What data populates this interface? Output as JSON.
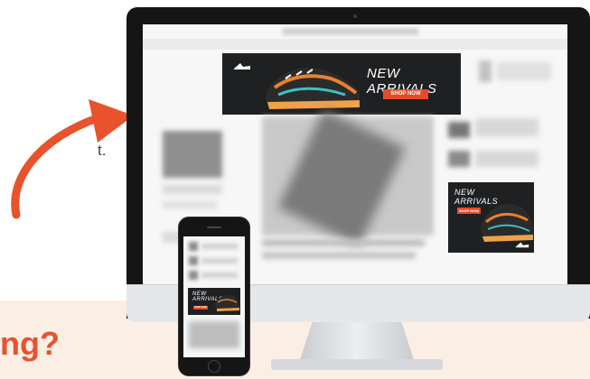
{
  "left_fragment": {
    "line1": "t",
    "line2": "t."
  },
  "headline_fragment": "ng?",
  "banner_ad": {
    "title": "NEW ARRIVALS",
    "button_label": "SHOP NOW"
  },
  "side_ad": {
    "title_line1": "NEW",
    "title_line2": "ARRIVALS",
    "button_label": "SHOP NOW"
  },
  "phone_ad": {
    "title_line1": "NEW",
    "title_line2": "ARRIVALS",
    "button_label": "SHOP NOW"
  },
  "colors": {
    "accent": "#e8522d",
    "band": "#fbeee5",
    "ad_background": "#1f2022",
    "button": "#e34b2b"
  },
  "icons": [
    "curved-arrow-icon",
    "sneaker-image",
    "brand-logo-icon"
  ]
}
